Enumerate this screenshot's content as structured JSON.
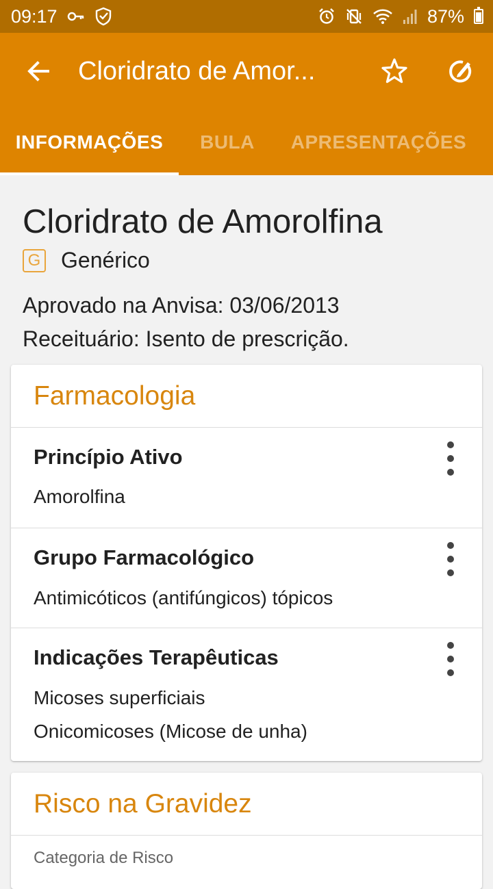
{
  "status_bar": {
    "time": "09:17",
    "battery": "87%",
    "icons": [
      "key-icon",
      "vpn-shield-icon",
      "alarm-icon",
      "vibrate-mute-icon",
      "wifi-icon",
      "signal-icon",
      "battery-icon"
    ]
  },
  "app_bar": {
    "title": "Cloridrato de Amor...",
    "back_icon": "arrow-back-icon",
    "favorite_icon": "star-outline-icon",
    "edit_icon": "edit-note-icon",
    "background_color": "#de8400"
  },
  "tabs": [
    {
      "label": "INFORMAÇÕES",
      "active": true
    },
    {
      "label": "BULA",
      "active": false
    },
    {
      "label": "APRESENTAÇÕES",
      "active": false
    }
  ],
  "drug": {
    "name": "Cloridrato de Amorolfina",
    "type_badge": "G",
    "type": "Genérico",
    "approval": "Aprovado na Anvisa: 03/06/2013",
    "prescription": "Receituário: Isento de prescrição."
  },
  "pharmacology": {
    "title": "Farmacologia",
    "items": [
      {
        "title": "Princípio Ativo",
        "values": [
          "Amorolfina"
        ]
      },
      {
        "title": "Grupo Farmacológico",
        "values": [
          "Antimicóticos (antifúngicos) tópicos"
        ]
      },
      {
        "title": "Indicações Terapêuticas",
        "values": [
          "Micoses superficiais",
          "Onicomicoses (Micose de unha)"
        ]
      }
    ]
  },
  "pregnancy": {
    "title": "Risco na Gravidez",
    "subtitle": "Categoria de Risco"
  },
  "colors": {
    "accent": "#de8400",
    "status_bar": "#b06d00",
    "card_title": "#d8860e"
  }
}
